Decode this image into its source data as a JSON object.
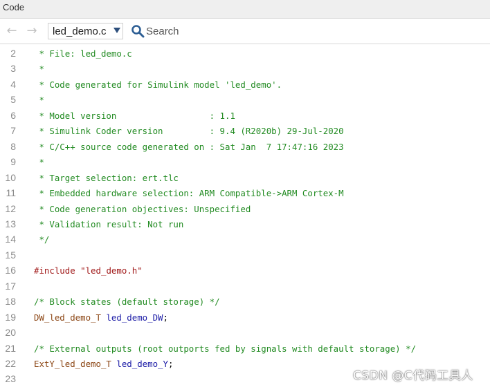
{
  "window": {
    "title": "Code"
  },
  "toolbar": {
    "file_selected": "led_demo.c",
    "search_placeholder": "Search"
  },
  "code": [
    {
      "num": "2",
      "tokens": [
        {
          "t": " * File: led_demo.c",
          "c": "comment"
        }
      ]
    },
    {
      "num": "3",
      "tokens": [
        {
          "t": " *",
          "c": "comment"
        }
      ]
    },
    {
      "num": "4",
      "tokens": [
        {
          "t": " * Code generated for Simulink model 'led_demo'.",
          "c": "comment"
        }
      ]
    },
    {
      "num": "5",
      "tokens": [
        {
          "t": " *",
          "c": "comment"
        }
      ]
    },
    {
      "num": "6",
      "tokens": [
        {
          "t": " * Model version                  : 1.1",
          "c": "comment"
        }
      ]
    },
    {
      "num": "7",
      "tokens": [
        {
          "t": " * Simulink Coder version         : 9.4 (R2020b) 29-Jul-2020",
          "c": "comment"
        }
      ]
    },
    {
      "num": "8",
      "tokens": [
        {
          "t": " * C/C++ source code generated on : Sat Jan  7 17:47:16 2023",
          "c": "comment"
        }
      ]
    },
    {
      "num": "9",
      "tokens": [
        {
          "t": " *",
          "c": "comment"
        }
      ]
    },
    {
      "num": "10",
      "tokens": [
        {
          "t": " * Target selection: ert.tlc",
          "c": "comment"
        }
      ]
    },
    {
      "num": "11",
      "tokens": [
        {
          "t": " * Embedded hardware selection: ARM Compatible->ARM Cortex-M",
          "c": "comment"
        }
      ]
    },
    {
      "num": "12",
      "tokens": [
        {
          "t": " * Code generation objectives: Unspecified",
          "c": "comment"
        }
      ]
    },
    {
      "num": "13",
      "tokens": [
        {
          "t": " * Validation result: Not run",
          "c": "comment"
        }
      ]
    },
    {
      "num": "14",
      "tokens": [
        {
          "t": " */",
          "c": "comment"
        }
      ]
    },
    {
      "num": "15",
      "tokens": []
    },
    {
      "num": "16",
      "tokens": [
        {
          "t": "#include ",
          "c": "preproc"
        },
        {
          "t": "\"led_demo.h\"",
          "c": "string"
        }
      ]
    },
    {
      "num": "17",
      "tokens": []
    },
    {
      "num": "18",
      "tokens": [
        {
          "t": "/* Block states (default storage) */",
          "c": "comment"
        }
      ]
    },
    {
      "num": "19",
      "tokens": [
        {
          "t": "DW_led_demo_T",
          "c": "type"
        },
        {
          "t": " ",
          "c": "plain"
        },
        {
          "t": "led_demo_DW",
          "c": "ident"
        },
        {
          "t": ";",
          "c": "plain"
        }
      ]
    },
    {
      "num": "20",
      "tokens": []
    },
    {
      "num": "21",
      "tokens": [
        {
          "t": "/* External outputs (root outports fed by signals with default storage) */",
          "c": "comment"
        }
      ]
    },
    {
      "num": "22",
      "tokens": [
        {
          "t": "ExtY_led_demo_T",
          "c": "type"
        },
        {
          "t": " ",
          "c": "plain"
        },
        {
          "t": "led_demo_Y",
          "c": "ident"
        },
        {
          "t": ";",
          "c": "plain"
        }
      ]
    },
    {
      "num": "23",
      "tokens": []
    }
  ],
  "watermark": "CSDN @C代码工具人",
  "colors": {
    "comment": "#228b22",
    "preproc": "#a01818",
    "type": "#8b4513",
    "ident": "#1a1aa6",
    "caret": "#2d4f7c"
  }
}
